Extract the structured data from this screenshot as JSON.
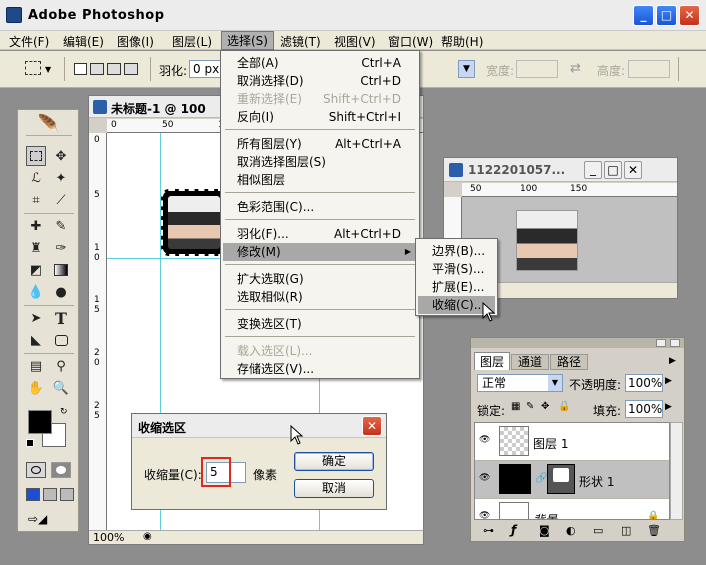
{
  "app": {
    "title": "Adobe Photoshop"
  },
  "menubar": [
    {
      "label": "文件(F)"
    },
    {
      "label": "编辑(E)"
    },
    {
      "label": "图像(I)"
    },
    {
      "label": "图层(L)"
    },
    {
      "label": "选择(S)"
    },
    {
      "label": "滤镜(T)"
    },
    {
      "label": "视图(V)"
    },
    {
      "label": "窗口(W)"
    },
    {
      "label": "帮助(H)"
    }
  ],
  "options": {
    "feather_label": "羽化:",
    "feather_value": "0 px",
    "width_label": "宽度:",
    "height_label": "高度:"
  },
  "select_menu": [
    {
      "label": "全部(A)",
      "shortcut": "Ctrl+A"
    },
    {
      "label": "取消选择(D)",
      "shortcut": "Ctrl+D"
    },
    {
      "label": "重新选择(E)",
      "shortcut": "Shift+Ctrl+D"
    },
    {
      "label": "反向(I)",
      "shortcut": "Shift+Ctrl+I"
    },
    {
      "label": "所有图层(Y)",
      "shortcut": "Alt+Ctrl+A"
    },
    {
      "label": "取消选择图层(S)",
      "shortcut": ""
    },
    {
      "label": "相似图层",
      "shortcut": ""
    },
    {
      "label": "色彩范围(C)...",
      "shortcut": ""
    },
    {
      "label": "羽化(F)...",
      "shortcut": "Alt+Ctrl+D"
    },
    {
      "label": "修改(M)",
      "shortcut": ""
    },
    {
      "label": "扩大选取(G)",
      "shortcut": ""
    },
    {
      "label": "选取相似(R)",
      "shortcut": ""
    },
    {
      "label": "变换选区(T)",
      "shortcut": ""
    },
    {
      "label": "载入选区(L)...",
      "shortcut": ""
    },
    {
      "label": "存储选区(V)...",
      "shortcut": ""
    }
  ],
  "modify_submenu": [
    {
      "label": "边界(B)..."
    },
    {
      "label": "平滑(S)..."
    },
    {
      "label": "扩展(E)..."
    },
    {
      "label": "收缩(C)..."
    }
  ],
  "doc1": {
    "title": "未标题-1 @ 100",
    "zoom": "100%",
    "ruler_h": [
      "0",
      "50",
      "1"
    ],
    "ruler_v": [
      "0",
      "5",
      "1",
      "0",
      "1",
      "5",
      "2",
      "0",
      "2",
      "5"
    ]
  },
  "doc2": {
    "title": "1122201057...",
    "ruler_h": [
      "50",
      "100",
      "150"
    ]
  },
  "dialog": {
    "title": "收缩选区",
    "label": "收缩量(C):",
    "value": "5",
    "unit": "像素",
    "ok": "确定",
    "cancel": "取消"
  },
  "layers": {
    "tabs": [
      "图层",
      "通道",
      "路径"
    ],
    "blend_mode": "正常",
    "opacity_label": "不透明度:",
    "opacity_value": "100%",
    "lock_label": "锁定:",
    "fill_label": "填充:",
    "fill_value": "100%",
    "items": [
      {
        "name": "图层 1"
      },
      {
        "name": "形状 1"
      },
      {
        "name": "背景"
      }
    ]
  },
  "colors": {
    "xp_blue": "#2b6bea",
    "selection_hl": "#a8a8a8",
    "dialog_red": "#e0281e"
  }
}
